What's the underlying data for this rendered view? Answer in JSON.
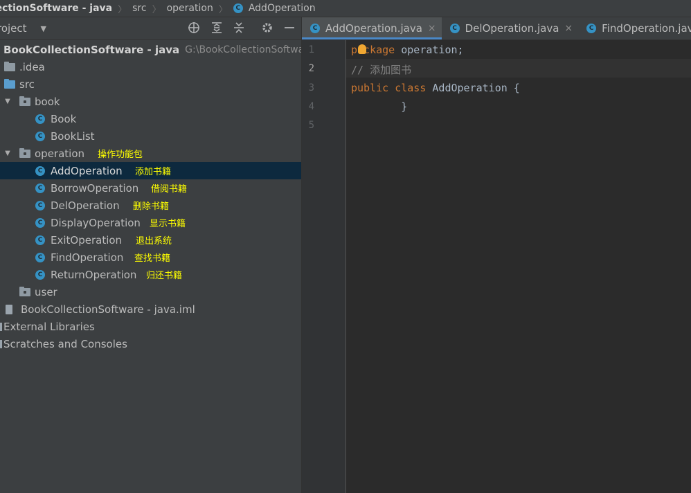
{
  "breadcrumb": {
    "project": "llectionSoftware - java",
    "folder": "src",
    "package": "operation",
    "class": "AddOperation",
    "class_icon": "C"
  },
  "project_panel": {
    "title": "roject",
    "tree": {
      "root_name": "BookCollectionSoftware - java",
      "root_path": "G:\\BookCollectionSoftware",
      "idea": ".idea",
      "src": "src",
      "book": "book",
      "book_classes": [
        "Book",
        "BookList"
      ],
      "operation": "operation",
      "operation_note": "操作功能包",
      "operation_classes": [
        {
          "name": "AddOperation",
          "note": "添加书籍"
        },
        {
          "name": "BorrowOperation",
          "note": "借阅书籍"
        },
        {
          "name": "DelOperation",
          "note": "删除书籍"
        },
        {
          "name": "DisplayOperation",
          "note": "显示书籍"
        },
        {
          "name": "ExitOperation",
          "note": "退出系统"
        },
        {
          "name": "FindOperation",
          "note": "查找书籍"
        },
        {
          "name": "ReturnOperation",
          "note": "归还书籍"
        }
      ],
      "user": "user",
      "iml": "BookCollectionSoftware - java.iml",
      "external_libraries": "External Libraries",
      "scratches": "Scratches and Consoles"
    }
  },
  "editor": {
    "tabs": [
      {
        "label": "AddOperation.java",
        "active": true
      },
      {
        "label": "DelOperation.java",
        "active": false
      },
      {
        "label": "FindOperation.java",
        "active": false
      }
    ],
    "close_glyph": "×",
    "line_numbers": [
      "1",
      "2",
      "3",
      "4",
      "5"
    ],
    "code": {
      "l1_kw": "package",
      "l1_rest": " operation;",
      "l2": "// 添加图书",
      "l3_kw1": "public",
      "l3_kw2": "class",
      "l3_name": "AddOperation",
      "l3_brace": " {",
      "l4": "        }"
    }
  },
  "colors": {
    "accent": "#4a88c7",
    "selection": "#0d293e",
    "keyword": "#cc7832",
    "annotation": "#ffff00",
    "class_icon": "#3592c4"
  }
}
